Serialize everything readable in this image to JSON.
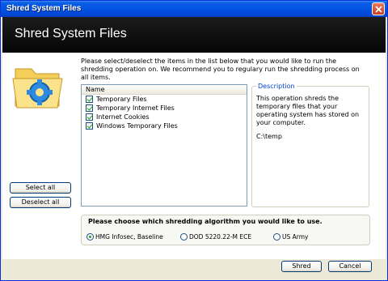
{
  "window": {
    "title": "Shred System Files"
  },
  "header": {
    "title": "Shred System Files"
  },
  "instruction": "Please select/deselect the items in the list below that you would like to run the shredding operation on. We recommend you to regulary run the shredding process on all items.",
  "list": {
    "column_header": "Name",
    "items": [
      {
        "label": "Temporary Files",
        "checked": true
      },
      {
        "label": "Temporary Internet Files",
        "checked": true
      },
      {
        "label": "Internet Cookies",
        "checked": true
      },
      {
        "label": "Windows Temporary Files",
        "checked": true
      }
    ]
  },
  "description": {
    "legend": "Description",
    "text": "This operation shreds the temporary files that your operating system has stored on your computer.",
    "path": "C:\\temp"
  },
  "buttons": {
    "select_all": "Select all",
    "deselect_all": "Deselect all",
    "shred": "Shred",
    "cancel": "Cancel"
  },
  "algorithm": {
    "title": "Please choose which shredding algorithm you would like to use.",
    "options": [
      {
        "label": "HMG Infosec, Baseline",
        "selected": true
      },
      {
        "label": "DOD 5220.22-M ECE",
        "selected": false
      },
      {
        "label": "US Army",
        "selected": false
      }
    ]
  },
  "icons": {
    "close": "close-icon",
    "folder": "folder-gear-icon"
  },
  "colors": {
    "titlebar": "#0454e2",
    "header": "#000000",
    "accent": "#0046d5"
  }
}
